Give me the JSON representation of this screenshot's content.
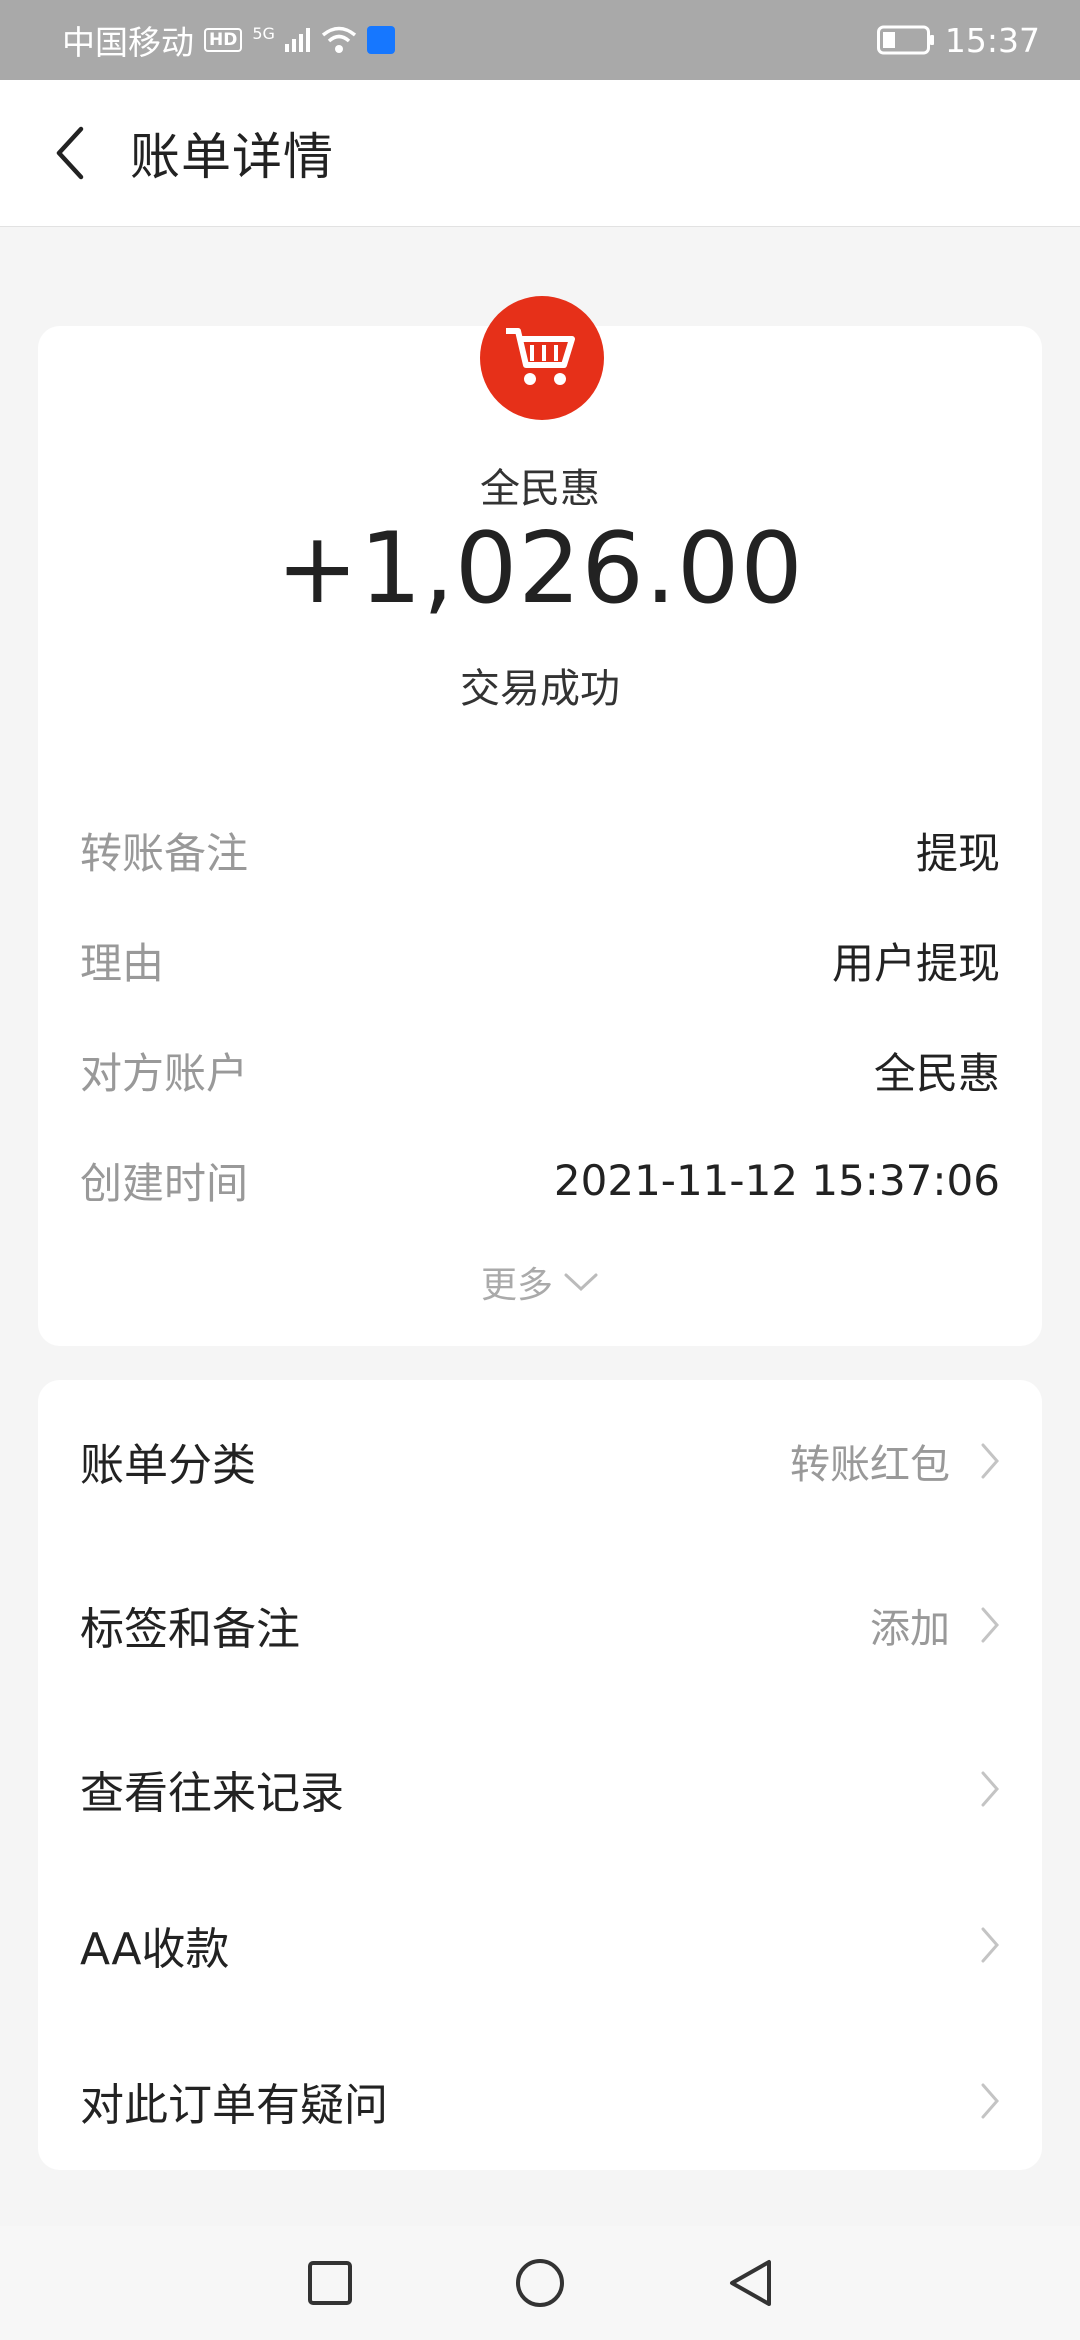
{
  "status_bar": {
    "carrier": "中国移动",
    "hd": "HD",
    "network": "5G",
    "time": "15:37"
  },
  "header": {
    "title": "账单详情"
  },
  "transaction": {
    "merchant_name": "全民惠",
    "amount": "+1,026.00",
    "status": "交易成功",
    "details": [
      {
        "label": "转账备注",
        "value": "提现"
      },
      {
        "label": "理由",
        "value": "用户提现"
      },
      {
        "label": "对方账户",
        "value": "全民惠"
      },
      {
        "label": "创建时间",
        "value": "2021-11-12 15:37:06"
      }
    ],
    "more_label": "更多"
  },
  "actions": [
    {
      "label": "账单分类",
      "value": "转账红包"
    },
    {
      "label": "标签和备注",
      "value": "添加"
    },
    {
      "label": "查看往来记录",
      "value": ""
    },
    {
      "label": "AA收款",
      "value": ""
    },
    {
      "label": "对此订单有疑问",
      "value": ""
    }
  ],
  "colors": {
    "status_bar_bg": "#a9a9a9",
    "page_bg": "#f5f5f5",
    "logo_red": "#e63019"
  },
  "icons": {
    "back": "chevron-left-icon",
    "more": "chevron-down-icon",
    "row_arrow": "chevron-right-icon",
    "nav_recent": "square-icon",
    "nav_home": "circle-icon",
    "nav_back": "triangle-back-icon"
  }
}
